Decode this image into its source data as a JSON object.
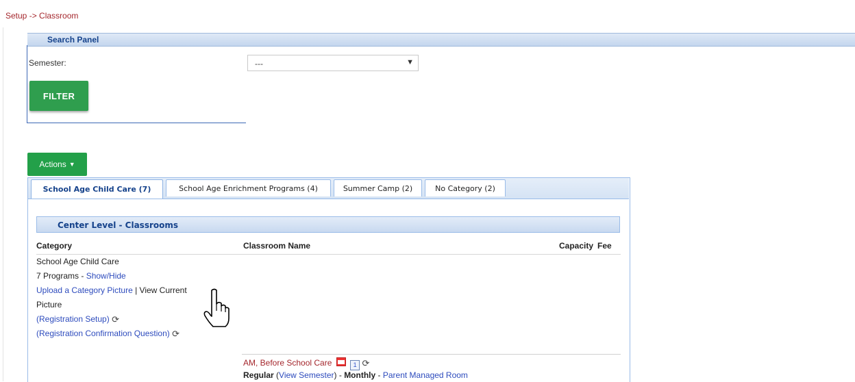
{
  "breadcrumb": "Setup -> Classroom",
  "search_panel": {
    "title": "Search Panel",
    "semester_label": "Semester:",
    "semester_value": "---",
    "filter_button": "FILTER"
  },
  "actions_button": "Actions",
  "tabs": [
    {
      "label": "School Age Child Care (7)",
      "active": true
    },
    {
      "label": "School Age Enrichment Programs (4)",
      "active": false
    },
    {
      "label": "Summer Camp (2)",
      "active": false
    },
    {
      "label": "No Category (2)",
      "active": false
    }
  ],
  "center_level": {
    "title": "Center Level - Classrooms",
    "columns": {
      "category": "Category",
      "classroom_name": "Classroom Name",
      "capacity": "Capacity",
      "fee": "Fee"
    }
  },
  "category_block": {
    "name": "School Age Child Care",
    "programs_count": "7 Programs",
    "dash": " - ",
    "show_hide": "Show/Hide",
    "upload_picture": "Upload a Category Picture",
    "separator": " | ",
    "view_current": "View Current",
    "picture": "Picture",
    "registration_setup": "(Registration Setup)",
    "registration_confirmation": "(Registration Confirmation Question)"
  },
  "classroom": {
    "name": "AM, Before School Care",
    "type": "Regular",
    "view_semester": "View Semester",
    "frequency": "Monthly",
    "parent_managed": "Parent Managed Room",
    "calendar_day": "1"
  },
  "icons": {
    "dropdown": "chevron-down-icon",
    "actions_caret": "caret-down-icon",
    "refresh": "refresh-icon",
    "calendar": "calendar-icon",
    "page": "page-icon",
    "cursor": "hand-pointer-icon"
  },
  "colors": {
    "breadcrumb": "#a4262c",
    "green_button": "#2f9e4e",
    "link": "#2d4bbd",
    "panel_header": "#15428b"
  }
}
